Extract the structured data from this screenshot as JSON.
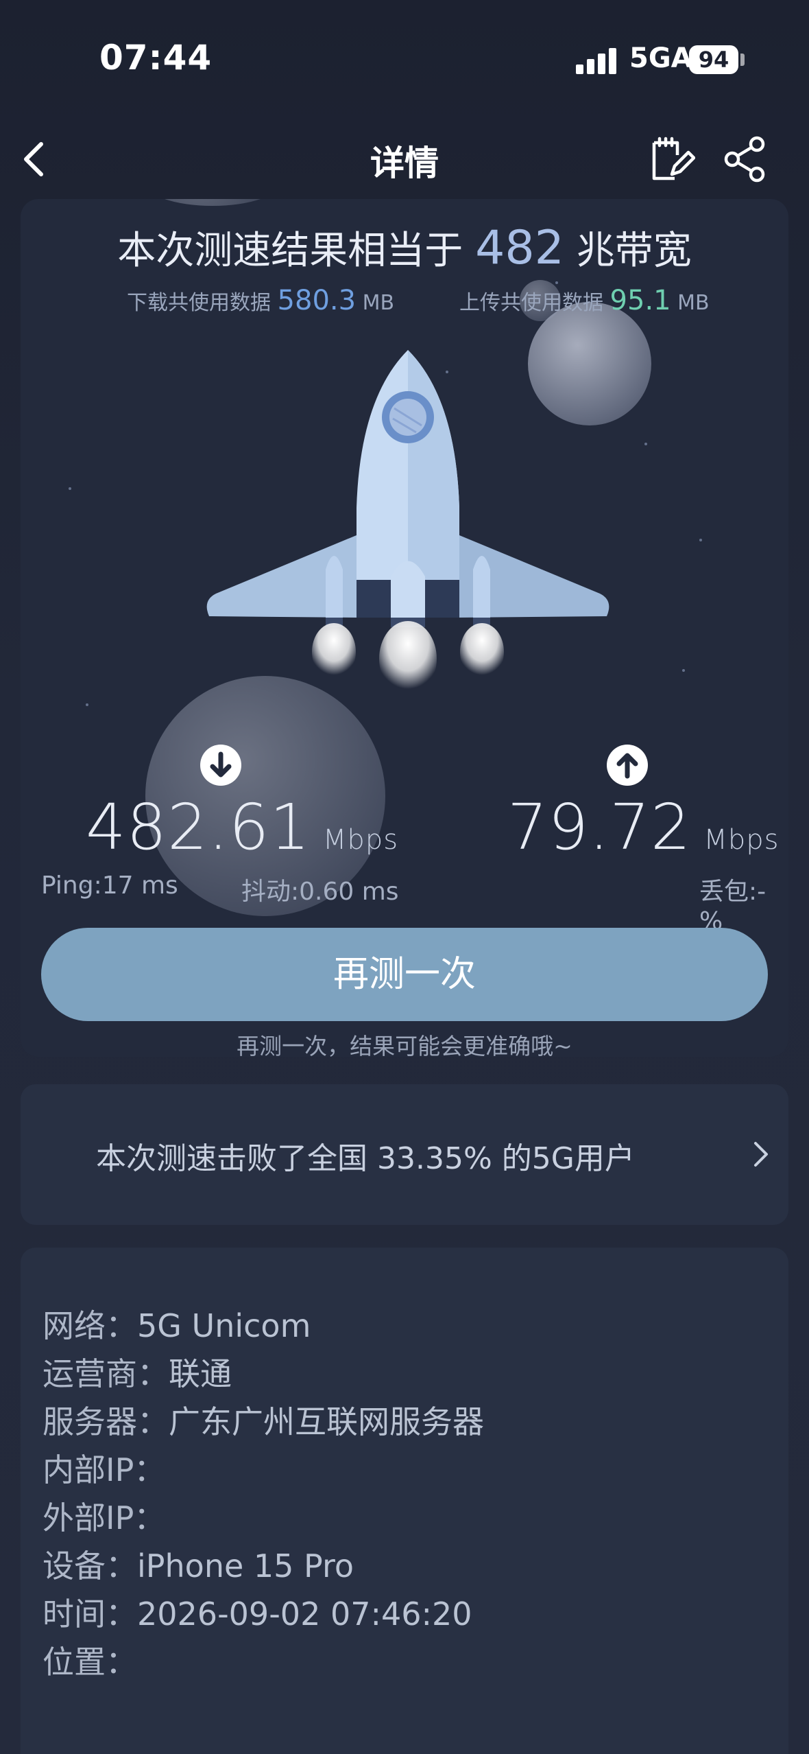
{
  "status_bar": {
    "time": "07:44",
    "network": "5GA",
    "battery": "94"
  },
  "header": {
    "title": "详情"
  },
  "summary": {
    "prefix": "本次测速结果相当于",
    "bandwidth": "482",
    "suffix": "兆带宽",
    "download_label": "下载共使用数据",
    "download_value": "580.3",
    "download_unit": "MB",
    "upload_label": "上传共使用数据",
    "upload_value": "95.1",
    "upload_unit": "MB"
  },
  "download": {
    "value": "482.61",
    "unit": "Mbps",
    "ping": "Ping:17 ms",
    "jitter": "抖动:0.60 ms"
  },
  "upload": {
    "value": "79.72",
    "unit": "Mbps",
    "loss": "丢包:-%"
  },
  "actions": {
    "retest_label": "再测一次",
    "retest_hint": "再测一次，结果可能会更准确哦~"
  },
  "rank": {
    "text": "本次测速击败了全国 33.35% 的5G用户"
  },
  "info": [
    {
      "key": "网络：",
      "value": "5G Unicom"
    },
    {
      "key": "运营商：",
      "value": "联通"
    },
    {
      "key": "服务器：",
      "value": "广东广州互联网服务器"
    },
    {
      "key": "内部IP：",
      "value": ""
    },
    {
      "key": "外部IP：",
      "value": ""
    },
    {
      "key": "设备：",
      "value": "iPhone 15 Pro"
    },
    {
      "key": "时间：",
      "value": "2026-09-02 07:46:20"
    },
    {
      "key": "位置：",
      "value": ""
    }
  ],
  "colors": {
    "accent": "#7ea3c0",
    "download_accent": "#6f9fe0",
    "upload_accent": "#6fcfb0",
    "background": "#232a3c"
  }
}
